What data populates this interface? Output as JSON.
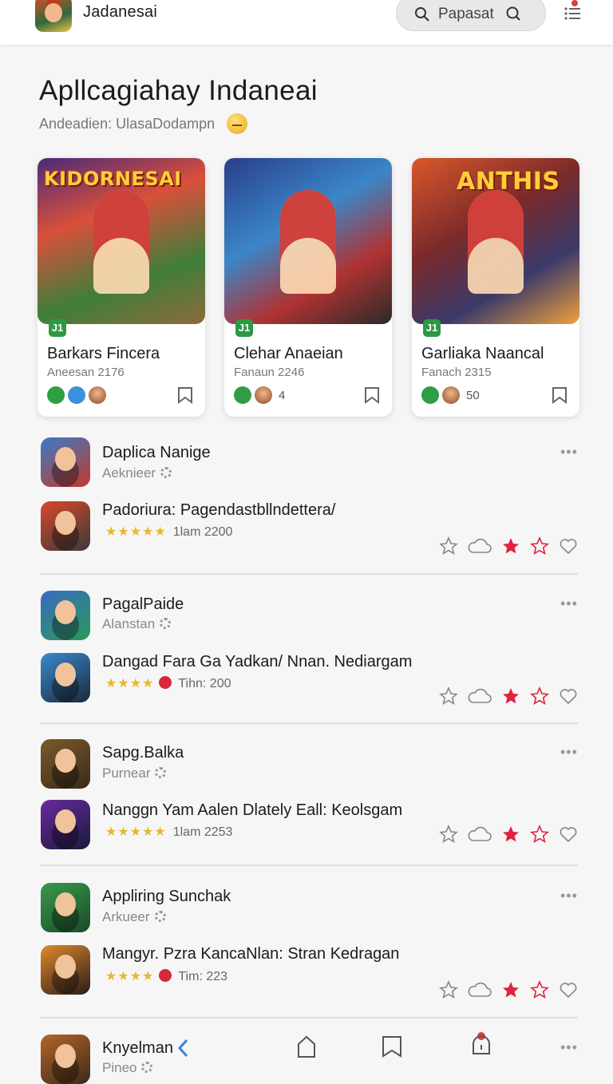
{
  "header": {
    "app_name": "Jadanesai",
    "search_text": "Papasat"
  },
  "page": {
    "title": "Apllcagiahay Indaneai",
    "subtitle": "Andeadien:  UlasaDodampn"
  },
  "cards": [
    {
      "banner": "KIDORNESAI",
      "badge": "J1",
      "title": "Barkars Fincera",
      "sub": "Aneesan 2176",
      "count": ""
    },
    {
      "banner": "",
      "badge": "J1",
      "title": "Clehar Anaeian",
      "sub": "Fanaun 2246",
      "count": "4"
    },
    {
      "banner": "ANTHIS",
      "badge": "J1",
      "title": "Garliaka Naancal",
      "sub": "Fanach 2315",
      "count": "50"
    }
  ],
  "list": [
    {
      "name": "Daplica Nanige",
      "developer": "Aeknieer",
      "desc": "Padoriura: Pagendastbllndettera/",
      "stars": "★★★★★",
      "meta": "1lam 2200",
      "heart": false
    },
    {
      "name": "PagalPaide",
      "developer": "Alanstan",
      "desc": "Dangad Fara Ga Yadkan/ Nnan. Nediargam",
      "stars": "★★★★",
      "meta": "Tihn: 200",
      "heart": true
    },
    {
      "name": "Sapg.Balka",
      "developer": "Purnear",
      "desc": "Nanggn Yam Aalen Dlately Eall: Keolsgam",
      "stars": "★★★★★",
      "meta": "1lam 2253",
      "heart": false
    },
    {
      "name": "Appliring Sunchak",
      "developer": "Arkueer",
      "desc": "Mangyr. Pzra KancaNlan: Stran Kedragan",
      "stars": "★★★★",
      "meta": "Tim: 223",
      "heart": true
    }
  ],
  "last_item": {
    "name": "Knyelman",
    "developer": "Pineo"
  },
  "colors": {
    "accent": "#2f9e44",
    "star": "#e8b828",
    "liked": "#e0233e",
    "notify": "#e23b3b"
  }
}
